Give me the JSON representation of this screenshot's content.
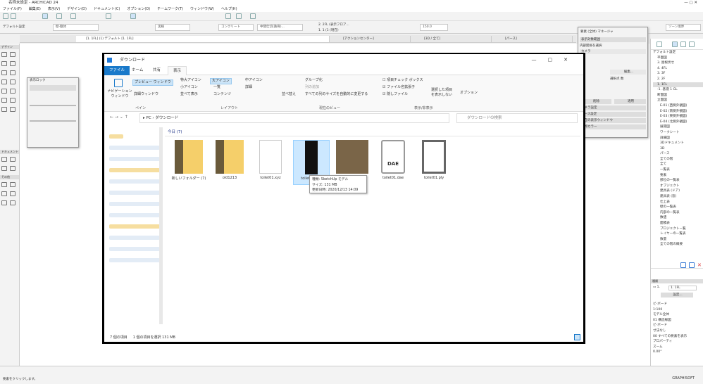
{
  "app": {
    "title": "名称未設定 - ARCHICAD 24",
    "menu": [
      "ファイル(F)",
      "編集(E)",
      "表示(V)",
      "デザイン(D)",
      "ドキュメント(C)",
      "オプション(O)",
      "チームワーク(T)",
      "ウィンドウ(W)",
      "ヘルプ(H)"
    ]
  },
  "infobox": {
    "label": "デフォルト設定",
    "layer": "壁-躯体",
    "line": "実線",
    "material": "コンクリート",
    "composite": "中間仕切(鉄骨)...",
    "story1": "2. 2FL (表示フロア...",
    "story2": "1. 1 (1 (現在)",
    "thickness": "150.0",
    "zone": "ゾーン境界"
  },
  "view_tabs": [
    "[1. 1FL] (1) デフォルト [1. 1FL]",
    "[アクションセンター]",
    "[3D / 全て]",
    "[パース]",
    "3. 各階平面図"
  ],
  "toolbox": {
    "design": "デザイン",
    "document": "ドキュメント",
    "more": "その他"
  },
  "float_palette": {
    "title": "表示ロック"
  },
  "explorer": {
    "title": "ダウンロード",
    "tabs": [
      "ファイル",
      "ホーム",
      "共有",
      "表示"
    ],
    "active_tab": "表示",
    "ribbon": {
      "pane": {
        "nav": "ナビゲーション ウィンドウ",
        "preview": "プレビュー ウィンドウ",
        "details": "詳細ウィンドウ",
        "label": "ペイン"
      },
      "layout": {
        "items": [
          "特大アイコン",
          "大アイコン",
          "中アイコン",
          "小アイコン",
          "一覧",
          "詳細",
          "並べて表示",
          "コンテンツ"
        ],
        "selected": "大アイコン",
        "label": "レイアウト"
      },
      "view": {
        "sort": "並べ替え",
        "group": "グループ化",
        "add_col": "列の追加",
        "fit": "すべての列のサイズを自動的に変更する",
        "label": "現在のビュー"
      },
      "show": {
        "checkbox": "項目チェック ボックス",
        "ext": "ファイル名拡張子",
        "hidden": "隠しファイル",
        "hide_sel": "選択した項目を表示しない",
        "label": "表示/非表示",
        "checkbox_checked": false,
        "ext_checked": true,
        "hidden_checked": true
      },
      "options": "オプション"
    },
    "address": [
      "PC",
      "ダウンロード"
    ],
    "search_placeholder": "ダウンロードの検索",
    "group": "今日 (7)",
    "files": [
      {
        "name": "新しいフォルダー (7)",
        "type": "folder"
      },
      {
        "name": "old1213",
        "type": "folder"
      },
      {
        "name": "toilet01.xyz",
        "type": "blank"
      },
      {
        "name": "toilet01.skp",
        "type": "skp",
        "selected": true
      },
      {
        "name": "toilet01.jpg",
        "type": "image"
      },
      {
        "name": "toilet01.dae",
        "type": "dae",
        "badge": "DAE"
      },
      {
        "name": "toilet01.ply",
        "type": "ply"
      }
    ],
    "tooltip": {
      "type": "種類: SketchUp モデル",
      "size": "サイズ: 131 MB",
      "date": "更新日時: 2020/12/13 14:09"
    },
    "status": {
      "count": "7 個の項目",
      "selected": "1 個の項目を選択  131 MB"
    }
  },
  "organizer": {
    "title": "要素 (全体) マネージャ",
    "section": "表示対象範囲",
    "select": "内部関係を選択",
    "field": "カメラ",
    "edit": "編集...",
    "points": "選択点 数",
    "btn1": "削除",
    "btn2": "適用",
    "rows": [
      "カメラ設定",
      "パース設定",
      "現在の表示ウィンドウ",
      "輪郭カラー"
    ]
  },
  "navigator": {
    "items": [
      "デフォルト設定",
      "平面図",
      "3. 屋根伏せ",
      "4. 4FL",
      "3. 3F",
      "2. 2F",
      "1. 1FL",
      "-1. 基礎 1 GL",
      "断面図",
      "立面図",
      "E-01 (西側外観図)",
      "E-02 (南側外観図)",
      "E-03 (東側外観図)",
      "E-04 (北側外観図)",
      "展開図",
      "ワークシート",
      "詳細図",
      "3Dドキュメント",
      "3D",
      "パース",
      "全ての階",
      "全て",
      "一覧表",
      "要素",
      "部位の一覧表",
      "オブジェクト",
      "建具表 (ドア)",
      "建具表 (窓)",
      "仕上表",
      "壁の一覧表",
      "内部の一覧表",
      "数値",
      "面積表",
      "プロジェクト一覧",
      "レイヤーの一覧表",
      "数量",
      "全ての階の概要"
    ],
    "selected": "1. 1FL"
  },
  "properties": {
    "title": "種類",
    "name": "1. 1FL",
    "settings": "設定...",
    "rows": [
      "ビ-ボード",
      "1:100",
      "モデル全体",
      "01 構造線図",
      "ビ-ボード",
      "寸法なし",
      "00 すべての要素を表示",
      "プロパーティ",
      "ズーム",
      "0.00°"
    ]
  },
  "status_bar": {
    "hint": "要素をクリックします。",
    "brand": "GRAPHISOFT"
  }
}
